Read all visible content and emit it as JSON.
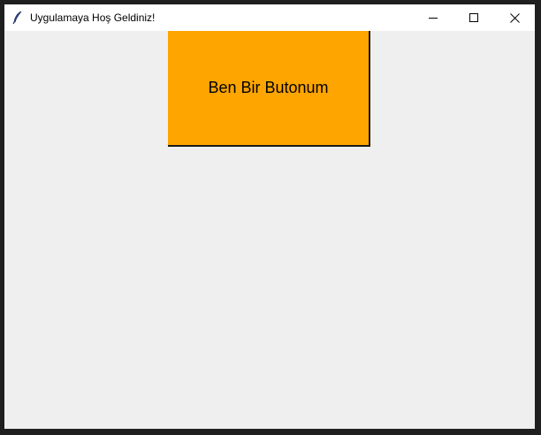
{
  "window": {
    "title": "Uygulamaya Hoş Geldiniz!",
    "icon": "feather-icon",
    "controls": {
      "minimize_icon": "minimize-icon",
      "maximize_icon": "maximize-icon",
      "close_icon": "close-icon"
    }
  },
  "main": {
    "button_label": "Ben Bir Butonum",
    "button_color": "#ffa500",
    "background_color": "#efefef"
  }
}
